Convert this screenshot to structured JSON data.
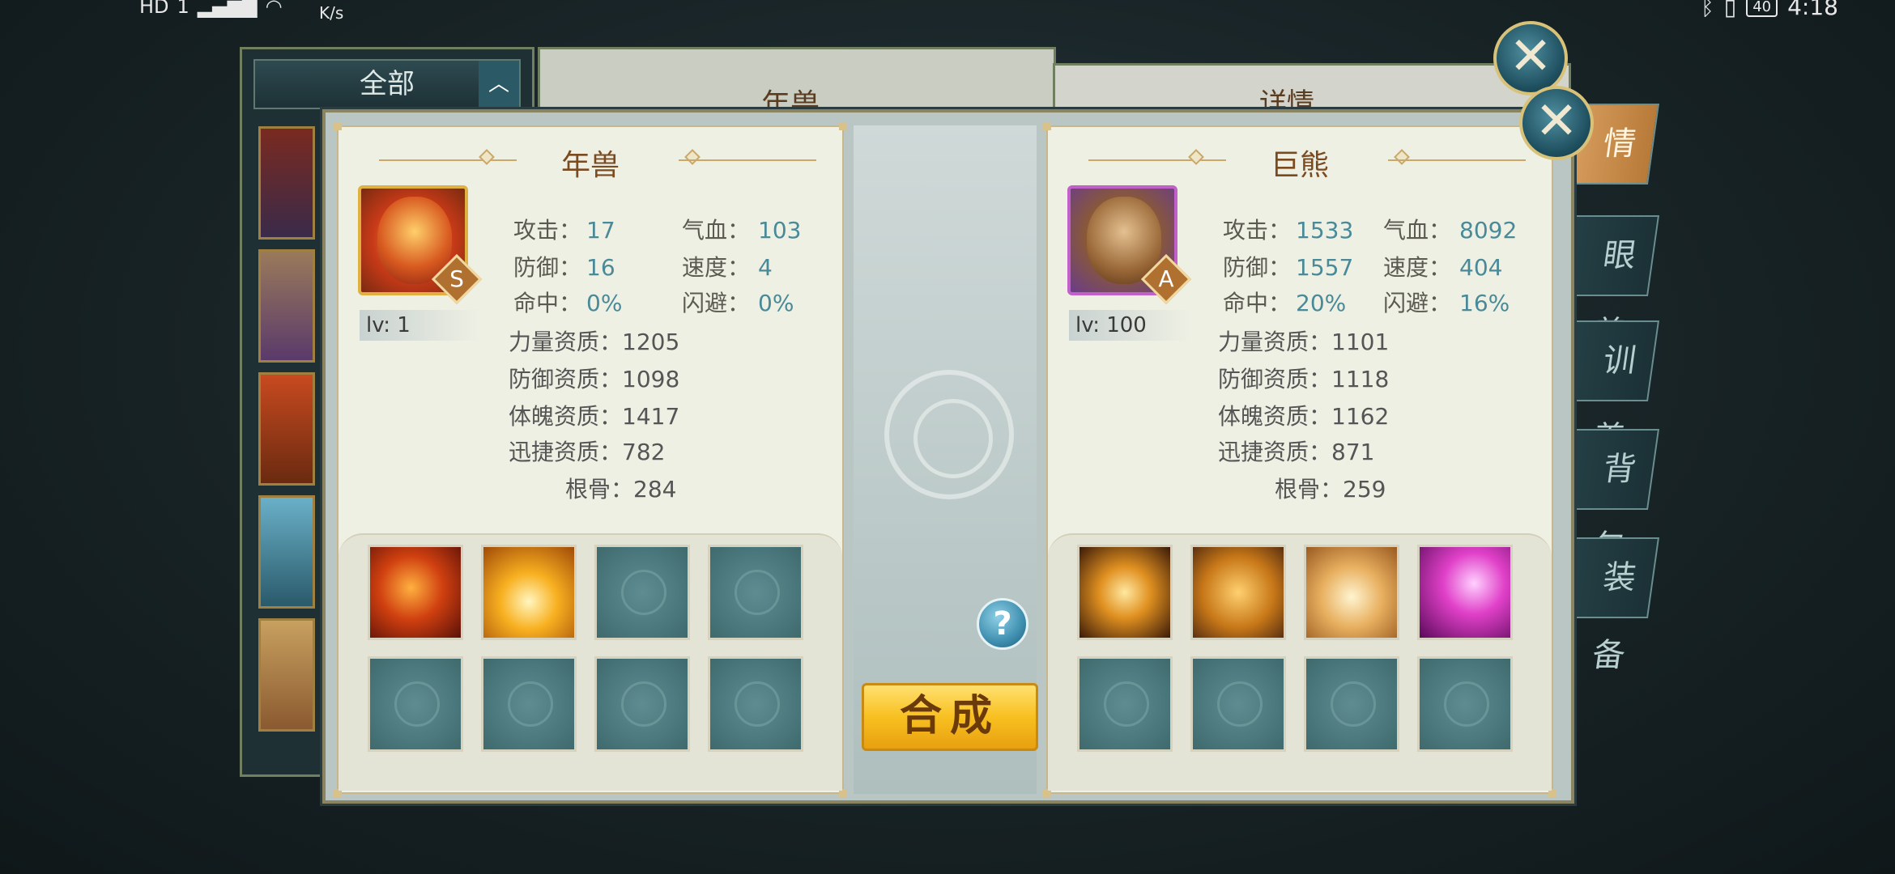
{
  "status_bar": {
    "left_icons": [
      "HD",
      "1"
    ],
    "net_speed_unit": "K/s",
    "battery": "40",
    "time": "4:18"
  },
  "background": {
    "filter_label": "全部",
    "middle_title": "年兽",
    "right_title": "详情",
    "side_tabs": [
      "情",
      "眼 养",
      "训 养",
      "背 包",
      "装 备"
    ]
  },
  "left_pet": {
    "name": "年兽",
    "grade": "S",
    "level": "lv: 1",
    "stats": [
      {
        "label": "攻击：",
        "value": "17"
      },
      {
        "label": "气血：",
        "value": "103"
      },
      {
        "label": "防御：",
        "value": "16"
      },
      {
        "label": "速度：",
        "value": "4"
      },
      {
        "label": "命中：",
        "value": "0%"
      },
      {
        "label": "闪避：",
        "value": "0%"
      }
    ],
    "aptitudes": [
      {
        "label": "力量资质：",
        "value": "1205"
      },
      {
        "label": "防御资质：",
        "value": "1098"
      },
      {
        "label": "体魄资质：",
        "value": "1417"
      },
      {
        "label": "迅捷资质：",
        "value": "782"
      },
      {
        "label": "根骨：",
        "value": "284"
      }
    ],
    "skills": [
      "fire-swirl-skill-icon",
      "golden-burst-skill-icon",
      "empty",
      "empty",
      "empty",
      "empty",
      "empty",
      "empty"
    ]
  },
  "right_pet": {
    "name": "巨熊",
    "grade": "A",
    "level": "lv: 100",
    "stats": [
      {
        "label": "攻击：",
        "value": "1533"
      },
      {
        "label": "气血：",
        "value": "8092"
      },
      {
        "label": "防御：",
        "value": "1557"
      },
      {
        "label": "速度：",
        "value": "404"
      },
      {
        "label": "命中：",
        "value": "20%"
      },
      {
        "label": "闪避：",
        "value": "16%"
      }
    ],
    "aptitudes": [
      {
        "label": "力量资质：",
        "value": "1101"
      },
      {
        "label": "防御资质：",
        "value": "1118"
      },
      {
        "label": "体魄资质：",
        "value": "1162"
      },
      {
        "label": "迅捷资质：",
        "value": "871"
      },
      {
        "label": "根骨：",
        "value": "259"
      }
    ],
    "skills": [
      "golden-cross-skill-icon",
      "lion-roar-skill-icon",
      "light-beast-skill-icon",
      "purple-lightning-skill-icon",
      "empty",
      "empty",
      "empty",
      "empty"
    ]
  },
  "actions": {
    "compose_label": "合成",
    "help_label": "?",
    "close_label": "✕"
  },
  "colors": {
    "stat_value": "#4a8a98",
    "title_brown": "#7a4a20",
    "button_gold": "#f8c020"
  }
}
